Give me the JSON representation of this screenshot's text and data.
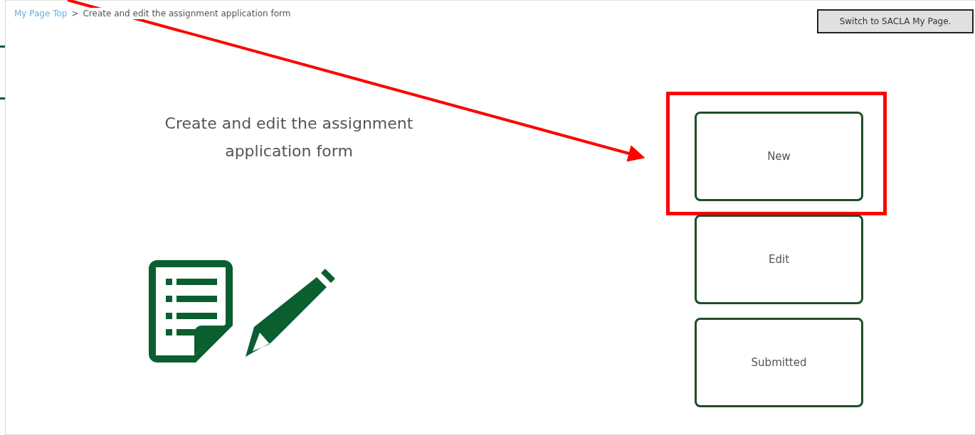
{
  "breadcrumb": [
    {
      "label": "My Page Top",
      "kind": "link"
    },
    {
      "label": ">",
      "kind": "separator"
    },
    {
      "label": "Create and edit the assignment application form",
      "kind": "current"
    }
  ],
  "switch_button": {
    "label": "Switch to SACLA My Page."
  },
  "heading": "Create and edit the assignment application form",
  "options": [
    {
      "label": "New",
      "highlighted": true
    },
    {
      "label": "Edit",
      "highlighted": false
    },
    {
      "label": "Submitted",
      "highlighted": false
    }
  ]
}
